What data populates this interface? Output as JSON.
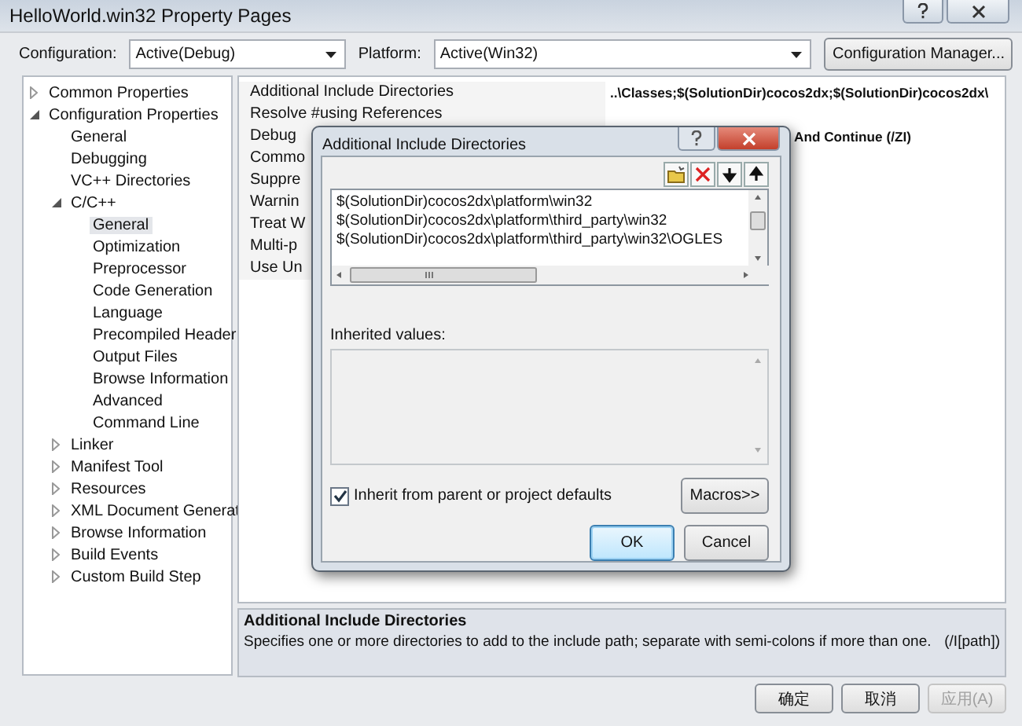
{
  "window": {
    "title": "HelloWorld.win32 Property Pages"
  },
  "toolbar": {
    "configuration_label": "Configuration:",
    "configuration": "Active(Debug)",
    "platform_label": "Platform:",
    "platform": "Active(Win32)",
    "manager_button": "Configuration Manager..."
  },
  "tree": [
    {
      "label": "Common Properties",
      "expanded": false,
      "selected": false
    },
    {
      "label": "Configuration Properties",
      "expanded": true,
      "selected": false,
      "children": [
        {
          "label": "General",
          "selected": false
        },
        {
          "label": "Debugging",
          "selected": false
        },
        {
          "label": "VC++ Directories",
          "selected": false
        },
        {
          "label": "C/C++",
          "expanded": true,
          "selected": false,
          "children": [
            {
              "label": "General",
              "selected": true
            },
            {
              "label": "Optimization",
              "selected": false
            },
            {
              "label": "Preprocessor",
              "selected": false
            },
            {
              "label": "Code Generation",
              "selected": false
            },
            {
              "label": "Language",
              "selected": false
            },
            {
              "label": "Precompiled Header",
              "selected": false
            },
            {
              "label": "Output Files",
              "selected": false
            },
            {
              "label": "Browse Information",
              "selected": false
            },
            {
              "label": "Advanced",
              "selected": false
            },
            {
              "label": "Command Line",
              "selected": false
            }
          ]
        },
        {
          "label": "Linker",
          "expanded": false,
          "selected": false
        },
        {
          "label": "Manifest Tool",
          "expanded": false,
          "selected": false
        },
        {
          "label": "Resources",
          "expanded": false,
          "selected": false
        },
        {
          "label": "XML Document Generat",
          "expanded": false,
          "selected": false
        },
        {
          "label": "Browse Information",
          "expanded": false,
          "selected": false
        },
        {
          "label": "Build Events",
          "expanded": false,
          "selected": false
        },
        {
          "label": "Custom Build Step",
          "expanded": false,
          "selected": false
        }
      ]
    }
  ],
  "properties": [
    {
      "name": "Additional Include Directories",
      "value": "..\\Classes;$(SolutionDir)cocos2dx;$(SolutionDir)cocos2dx\\"
    },
    {
      "name": "Resolve #using References"
    },
    {
      "name": "Debug",
      "value": "And Continue (/ZI)"
    },
    {
      "name": "Commo"
    },
    {
      "name": "Suppre"
    },
    {
      "name": "Warnin"
    },
    {
      "name": "Treat W"
    },
    {
      "name": "Multi-p"
    },
    {
      "name": "Use Un"
    }
  ],
  "description": {
    "title": "Additional Include Directories",
    "text": "Specifies one or more directories to add to the include path; separate with semi-colons if more than one.",
    "switch": "(/I[path])"
  },
  "buttons": [
    {
      "label": "确定",
      "disabled": false
    },
    {
      "label": "取消",
      "disabled": false
    },
    {
      "label": "应用(A)",
      "disabled": true
    }
  ],
  "dialog": {
    "title": "Additional Include Directories",
    "entries": [
      "$(SolutionDir)cocos2dx\\platform\\win32",
      "$(SolutionDir)cocos2dx\\platform\\third_party\\win32",
      "$(SolutionDir)cocos2dx\\platform\\third_party\\win32\\OGLES"
    ],
    "inherited_label": "Inherited values:",
    "inherit_checkbox": {
      "label": "Inherit from parent or project defaults",
      "checked": true
    },
    "macros_button": "Macros>>",
    "ok_button": "OK",
    "cancel_button": "Cancel"
  }
}
